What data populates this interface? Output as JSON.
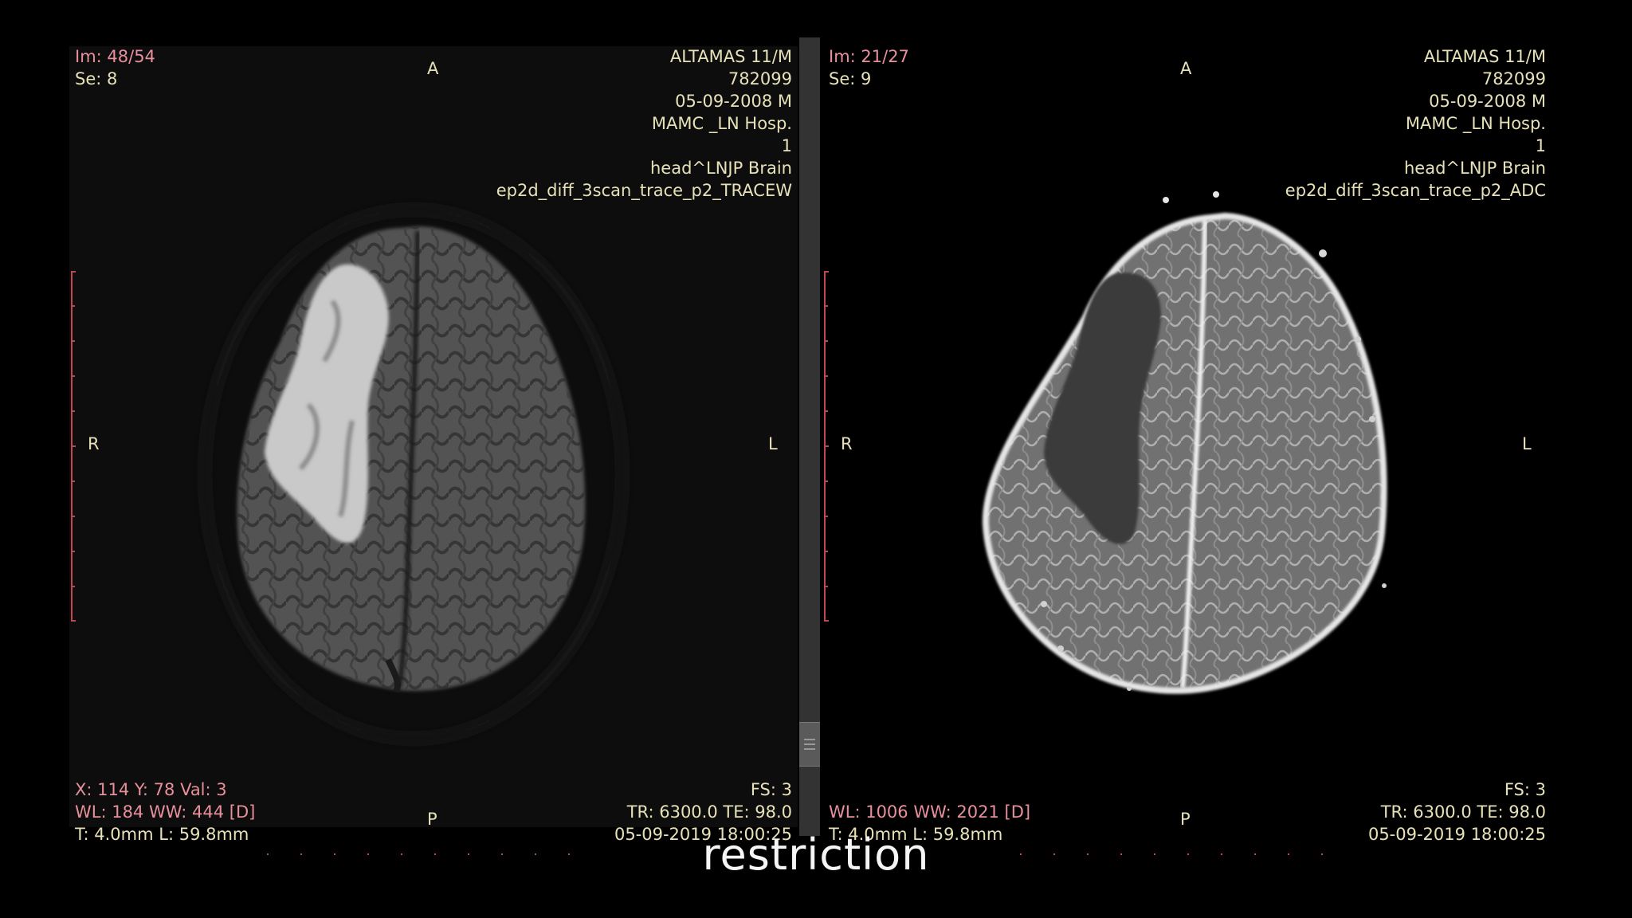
{
  "left_viewport": {
    "image_index": "Im: 48/54",
    "series": "Se: 8",
    "patient_name": "ALTAMAS 11/M",
    "patient_id": "782099",
    "study_date": "05-09-2008 M",
    "institution": "MAMC _LN Hosp.",
    "study_number": "1",
    "study_description": "head^LNJP Brain",
    "sequence": "ep2d_diff_3scan_trace_p2_TRACEW",
    "cursor_readout": "X: 114 Y: 78 Val: 3",
    "window_level": "WL: 184 WW: 444 [D]",
    "thickness_location": "T: 4.0mm L: 59.8mm",
    "field_strength": "FS: 3",
    "tr_te": "TR: 6300.0 TE: 98.0",
    "acquisition_datetime": "05-09-2019 18:00:25",
    "orientation": {
      "top": "A",
      "bottom": "P",
      "left": "R",
      "right": "L"
    }
  },
  "right_viewport": {
    "image_index": "Im: 21/27",
    "series": "Se: 9",
    "patient_name": "ALTAMAS 11/M",
    "patient_id": "782099",
    "study_date": "05-09-2008 M",
    "institution": "MAMC _LN Hosp.",
    "study_number": "1",
    "study_description": "head^LNJP Brain",
    "sequence": "ep2d_diff_3scan_trace_p2_ADC",
    "window_level": "WL: 1006 WW: 2021 [D]",
    "thickness_location": "T: 4.0mm L: 59.8mm",
    "field_strength": "FS: 3",
    "tr_te": "TR: 6300.0 TE: 98.0",
    "acquisition_datetime": "05-09-2019 18:00:25",
    "orientation": {
      "top": "A",
      "bottom": "P",
      "left": "R",
      "right": "L"
    }
  },
  "caption": "restriction",
  "colors": {
    "overlay_pink": "#e7909b",
    "overlay_yellow": "#e7e1b8",
    "ruler_red": "#c0474f"
  }
}
